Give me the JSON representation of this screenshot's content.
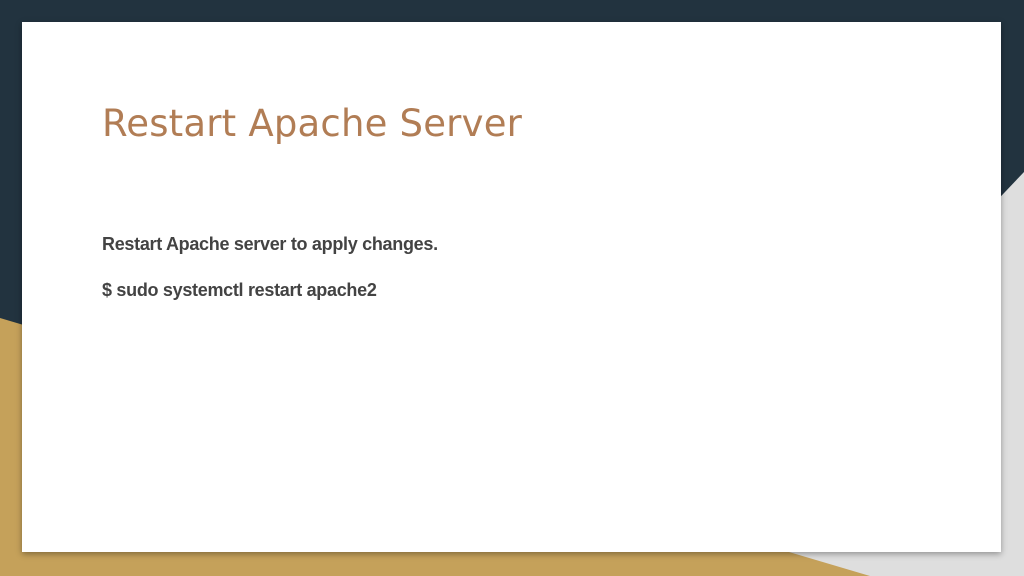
{
  "colors": {
    "background_dark": "#22333f",
    "background_gold": "#c5a15a",
    "background_light": "#dedede",
    "card": "#ffffff",
    "title": "#b17d55",
    "body_text": "#434343"
  },
  "slide": {
    "title": "Restart Apache Server",
    "paragraphs": [
      "Restart Apache server to apply changes.",
      "$ sudo systemctl restart apache2"
    ]
  }
}
